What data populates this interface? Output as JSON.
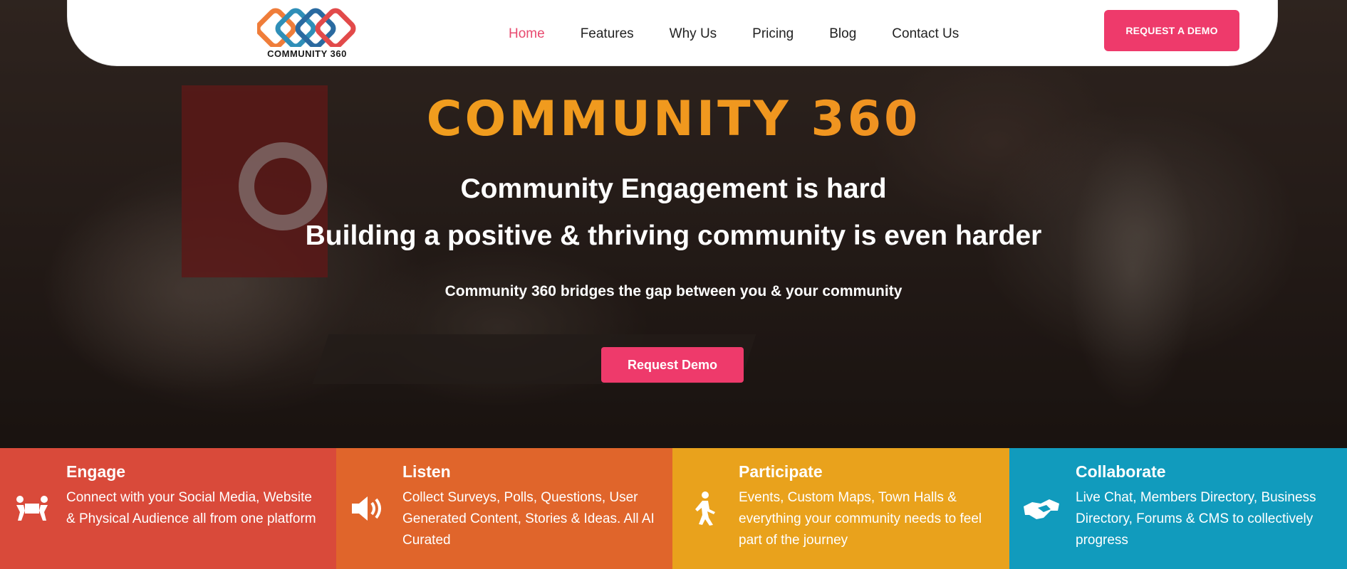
{
  "header": {
    "logo_text": "COMMUNITY 360",
    "nav": [
      "Home",
      "Features",
      "Why Us",
      "Pricing",
      "Blog",
      "Contact Us"
    ],
    "active_nav": "Home",
    "demo_button": "REQUEST A DEMO"
  },
  "hero": {
    "brand_title": "COMMUNITY 360",
    "headline_1": "Community Engagement is hard",
    "headline_2": "Building a positive & thriving community is even harder",
    "subheadline": "Community 360 bridges the gap between you & your community",
    "cta_button": "Request Demo"
  },
  "features": [
    {
      "title": "Engage",
      "description": "Connect with your Social Media, Website & Physical Audience all from one platform",
      "icon": "people-carry-icon",
      "color": "#d94a3a"
    },
    {
      "title": "Listen",
      "description": "Collect Surveys, Polls, Questions, User Generated Content, Stories & Ideas. All AI Curated",
      "icon": "speaker-icon",
      "color": "#e0652b"
    },
    {
      "title": "Participate",
      "description": "Events, Custom Maps, Town Halls & everything your community needs to feel part of the journey",
      "icon": "walking-person-icon",
      "color": "#e9a21c"
    },
    {
      "title": "Collaborate",
      "description": "Live Chat, Members Directory, Business Directory, Forums & CMS to collectively progress",
      "icon": "handshake-icon",
      "color": "#119bbd"
    }
  ],
  "colors": {
    "accent_pink": "#ee3a6b",
    "brand_orange": "#f0a51c",
    "nav_active": "#e84a6f"
  }
}
